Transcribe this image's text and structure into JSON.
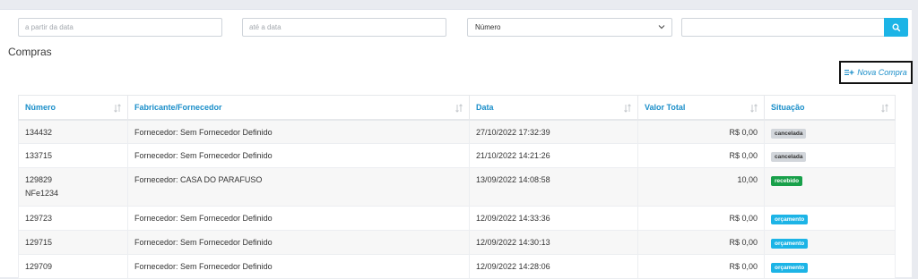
{
  "filters": {
    "date_from_placeholder": "a partir da data",
    "date_to_placeholder": "até a data",
    "field_select_value": "Número",
    "search_value": ""
  },
  "page": {
    "title": "Compras",
    "new_button_label": "Nova Compra"
  },
  "table": {
    "headers": {
      "numero": "Número",
      "fabricante": "Fabricante/Fornecedor",
      "data": "Data",
      "valor_total": "Valor Total",
      "situacao": "Situação"
    },
    "rows": [
      {
        "numero": "134432",
        "numero2": "",
        "fornecedor": "Fornecedor: Sem Fornecedor Definido",
        "data": "27/10/2022 17:32:39",
        "valor": "R$ 0,00",
        "situacao": "cancelada"
      },
      {
        "numero": "133715",
        "numero2": "",
        "fornecedor": "Fornecedor: Sem Fornecedor Definido",
        "data": "21/10/2022 14:21:26",
        "valor": "R$ 0,00",
        "situacao": "cancelada"
      },
      {
        "numero": "129829",
        "numero2": "NFe1234",
        "fornecedor": "Fornecedor: CASA DO PARAFUSO",
        "data": "13/09/2022 14:08:58",
        "valor": "10,00",
        "situacao": "recebido"
      },
      {
        "numero": "129723",
        "numero2": "",
        "fornecedor": "Fornecedor: Sem Fornecedor Definido",
        "data": "12/09/2022 14:33:36",
        "valor": "R$ 0,00",
        "situacao": "orçamento"
      },
      {
        "numero": "129715",
        "numero2": "",
        "fornecedor": "Fornecedor: Sem Fornecedor Definido",
        "data": "12/09/2022 14:30:13",
        "valor": "R$ 0,00",
        "situacao": "orçamento"
      },
      {
        "numero": "129709",
        "numero2": "",
        "fornecedor": "Fornecedor: Sem Fornecedor Definido",
        "data": "12/09/2022 14:28:06",
        "valor": "R$ 0,00",
        "situacao": "orçamento"
      }
    ]
  },
  "icons": {
    "select_chevron": "chevron-down-icon",
    "search": "search-icon",
    "new": "add-list-icon",
    "sort": "sort-icon"
  },
  "colors": {
    "accent": "#1cb4e6",
    "link": "#1a8ec9",
    "status_cancelada": "#d2d6db",
    "status_recebido": "#18a04a",
    "status_orcamento": "#1cb4e6"
  }
}
